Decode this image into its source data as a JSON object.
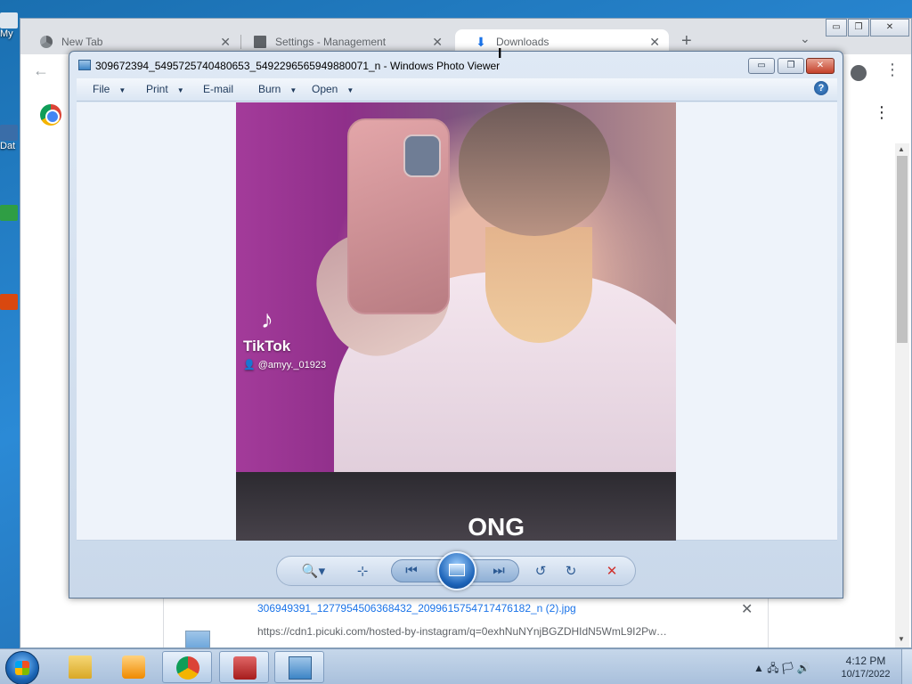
{
  "desktop": {
    "icon_labels": [
      "My",
      "Dat"
    ]
  },
  "chrome": {
    "tabs": [
      {
        "label": "New Tab",
        "icon": "chrome-icon"
      },
      {
        "label": "Settings - Management",
        "icon": "building-icon"
      },
      {
        "label": "Downloads",
        "icon": "download-icon"
      }
    ],
    "new_tab_glyph": "+",
    "tab_search_glyph": "⌄",
    "window_controls": [
      "▭",
      "❐",
      "✕"
    ],
    "back_glyph": "←",
    "menu_glyph": "⋮",
    "download": {
      "filename": "306949391_1277954506368432_2099615754717476182_n (2).jpg",
      "url": "https://cdn1.picuki.com/hosted-by-instagram/q=0exhNuNYnjBGZDHIdN5WmL9I2Pw…",
      "close_glyph": "✕"
    }
  },
  "viewer": {
    "title": "309672394_5495725740480653_5492296565949880071_n - Windows Photo Viewer",
    "controls": {
      "minimize": "▭",
      "maximize": "❐",
      "close": "✕"
    },
    "menu": [
      {
        "label": "File",
        "has_arrow": true
      },
      {
        "label": "Print",
        "has_arrow": true
      },
      {
        "label": "E-mail",
        "has_arrow": false
      },
      {
        "label": "Burn",
        "has_arrow": true
      },
      {
        "label": "Open",
        "has_arrow": true
      }
    ],
    "menu_arrow": "▼",
    "help_glyph": "?",
    "photo": {
      "tiktok_logo": "♪",
      "tiktok_name": "TikTok",
      "tiktok_user": "👤 @amyy._01923",
      "caption": "ONG"
    },
    "toolbar": {
      "zoom": "🔍▾",
      "fit": "⊹",
      "previous": "⏮",
      "next": "⏭",
      "rotate_ccw": "↺",
      "rotate_cw": "↻",
      "delete": "✕"
    }
  },
  "taskbar": {
    "tray_icons": "▲  🖧  🏳  🔊",
    "time": "4:12 PM",
    "date": "10/17/2022"
  },
  "colors": {
    "delete_red": "#d0312d",
    "link_blue": "#1a73e8"
  }
}
